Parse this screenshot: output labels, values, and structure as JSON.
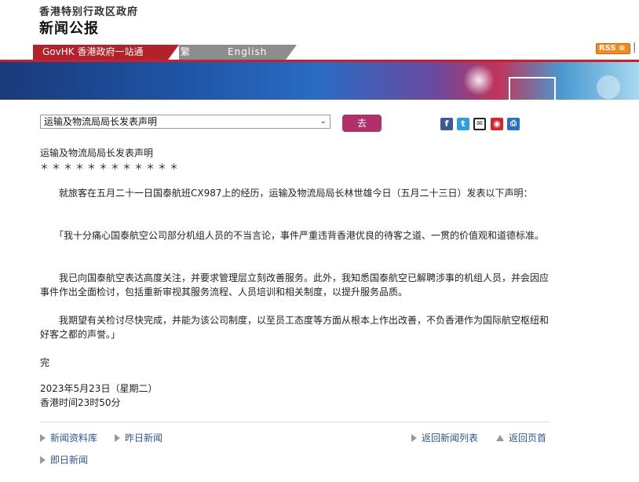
{
  "header": {
    "org": "香港特别行政区政府",
    "bulletin": "新闻公报",
    "nav": {
      "govhk": "GovHK 香港政府一站通",
      "traditional": "繁體版",
      "english": "English"
    },
    "rss": "RSS"
  },
  "toolbar": {
    "selected": "运输及物流局局长发表声明",
    "go": "去"
  },
  "share_icons": [
    "facebook-icon",
    "twitter-icon",
    "mail-icon",
    "weibo-icon",
    "print-icon"
  ],
  "article": {
    "title": "运输及物流局局长发表声明",
    "stars": "＊＊＊＊＊＊＊＊＊＊＊＊",
    "paragraphs": [
      "　　就旅客在五月二十一日国泰航班CX987上的经历，运输及物流局局长林世雄今日（五月二十三日）发表以下声明：",
      "　　「我十分痛心国泰航空公司部分机组人员的不当言论，事件严重违背香港优良的待客之道、一贯的价值观和道德标准。",
      "　　我已向国泰航空表达高度关注，并要求管理层立刻改善服务。此外，我知悉国泰航空已解聘涉事的机组人员，并会因应事件作出全面检讨，包括重新审视其服务流程、人员培训和相关制度，以提升服务品质。",
      "　　我期望有关检讨尽快完成，并能为该公司制度，以至员工态度等方面从根本上作出改善，不负香港作为国际航空枢纽和好客之都的声誉。」"
    ],
    "end": "完",
    "date": "2023年5月23日（星期二）",
    "time": "香港时间23时50分"
  },
  "footer": {
    "archive": "新闻资料库",
    "yesterday": "昨日新闻",
    "list": "返回新闻列表",
    "top": "返回页首",
    "today": "即日新闻"
  },
  "colors": {
    "accent_red": "#b3222a",
    "go_button": "#b0306a",
    "link": "#2f55a0"
  }
}
